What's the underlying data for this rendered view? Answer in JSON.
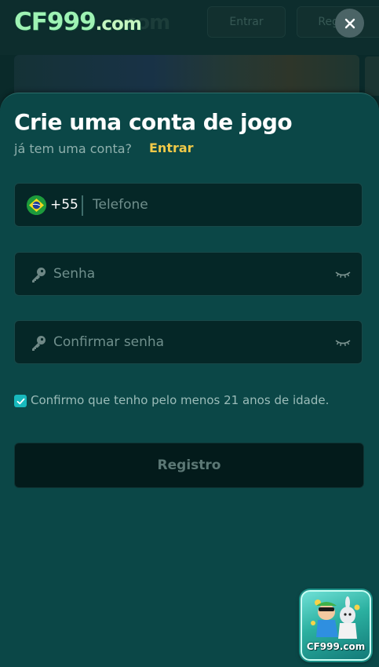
{
  "header": {
    "logo_main": "CF999",
    "logo_suffix": ".com",
    "bg_enter_label": "Entrar",
    "bg_register_label": "Registro"
  },
  "sheet": {
    "title": "Crie uma conta de jogo",
    "subtitle": "já tem uma conta?",
    "login_link": "Entrar",
    "phone": {
      "country_code": "+55",
      "placeholder": "Telefone",
      "flag_icon": "brazil-flag-icon"
    },
    "password": {
      "placeholder": "Senha"
    },
    "confirm_password": {
      "placeholder": "Confirmar senha"
    },
    "age_confirm": {
      "label": "Confirmo que tenho pelo menos 21 anos de idade.",
      "checked": true
    },
    "register_label": "Registro"
  },
  "promo": {
    "label": "CF999.com"
  },
  "colors": {
    "sheet_bg": "#0b4747",
    "field_bg": "#052727",
    "accent_yellow": "#f0c948",
    "checkbox": "#18b9bd",
    "button_bg": "#031b1b"
  }
}
